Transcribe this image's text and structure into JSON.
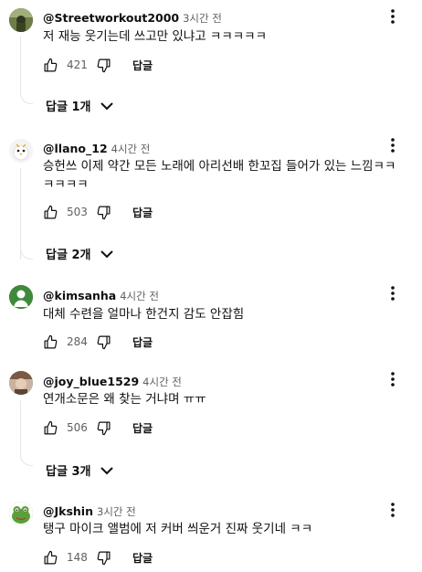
{
  "comments": [
    {
      "author": "@Streetworkout2000",
      "time": "3시간 전",
      "text": "저 재능 웃기는데 쓰고만 있냐고 ㅋㅋㅋㅋㅋ",
      "likes": "421",
      "reply_label": "답글",
      "replies_label": "답글 1개",
      "avatar_icon": "avatar-photo-icon",
      "avatar_color": "#5a6b3a"
    },
    {
      "author": "@llano_12",
      "time": "4시간 전",
      "text": "승헌쓰 이제 약간 모든 노래에 아리선배 한꼬집 들어가 있는 느낌ㅋㅋㅋㅋㅋㅋ",
      "likes": "503",
      "reply_label": "답글",
      "replies_label": "답글 2개",
      "avatar_icon": "bird-avatar-icon",
      "avatar_color": "#f2f2f2"
    },
    {
      "author": "@kimsanha",
      "time": "4시간 전",
      "text": "대체 수련을 얼마나 한건지 감도 안잡힘",
      "likes": "284",
      "reply_label": "답글",
      "avatar_icon": "person-avatar-icon",
      "avatar_color": "#3f8a3a"
    },
    {
      "author": "@joy_blue1529",
      "time": "4시간 전",
      "text": "연개소문은 왜 찾는 거냐며 ㅠㅠ",
      "likes": "506",
      "reply_label": "답글",
      "replies_label": "답글 3개",
      "avatar_icon": "avatar-photo-icon",
      "avatar_color": "#8a6a55"
    },
    {
      "author": "@Jkshin",
      "time": "3시간 전",
      "text": "탱구 마이크 앨범에 저 커버 씌운거 진짜 웃기네 ㅋㅋ",
      "likes": "148",
      "reply_label": "답글",
      "avatar_icon": "frog-avatar-icon",
      "avatar_color": "#4f9a3a"
    }
  ]
}
